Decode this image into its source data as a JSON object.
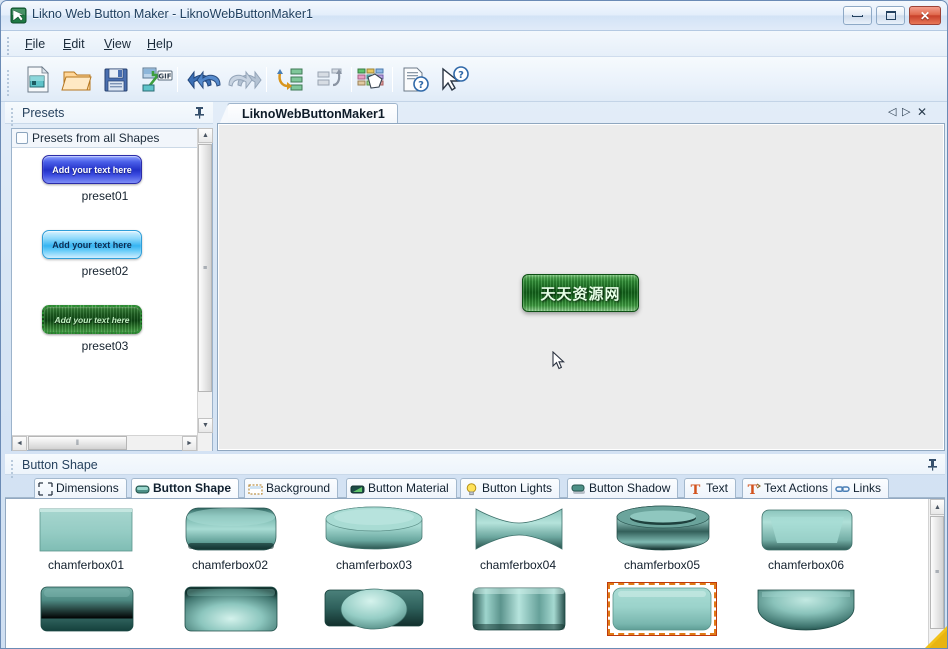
{
  "window": {
    "title": "Likno Web Button Maker - LiknoWebButtonMaker1",
    "app_icon": "likno-app-icon",
    "minimize_label": "Minimize",
    "maximize_label": "Maximize",
    "close_label": "Close"
  },
  "menu": {
    "items": [
      {
        "label": "File",
        "accel": "F"
      },
      {
        "label": "Edit",
        "accel": "E"
      },
      {
        "label": "View",
        "accel": "V"
      },
      {
        "label": "Help",
        "accel": "H"
      }
    ]
  },
  "toolbar": {
    "buttons": [
      {
        "name": "new-project-icon",
        "tooltip": "New"
      },
      {
        "name": "open-project-icon",
        "tooltip": "Open"
      },
      {
        "name": "save-project-icon",
        "tooltip": "Save"
      },
      {
        "name": "export-gif-icon",
        "tooltip": "Export GIF"
      },
      {
        "name": "undo-icon",
        "tooltip": "Undo"
      },
      {
        "name": "redo-icon",
        "tooltip": "Redo"
      },
      {
        "name": "import-buttons-icon",
        "tooltip": "Import"
      },
      {
        "name": "export-buttons-icon",
        "tooltip": "Export"
      },
      {
        "name": "properties-icon",
        "tooltip": "Properties"
      },
      {
        "name": "help-topics-icon",
        "tooltip": "Help Topics"
      },
      {
        "name": "whats-this-icon",
        "tooltip": "What's This?"
      }
    ]
  },
  "presets_panel": {
    "caption": "Presets",
    "pin_glyph": "⟐",
    "all_shapes_checkbox": {
      "label": "Presets from all Shapes",
      "checked": false
    },
    "items": [
      {
        "name": "preset01",
        "button_text": "Add your text here",
        "style": "pbtn1"
      },
      {
        "name": "preset02",
        "button_text": "Add your text here",
        "style": "pbtn2"
      },
      {
        "name": "preset03",
        "button_text": "Add your text here",
        "style": "pbtn3"
      }
    ],
    "scroll_h_thumb_glyph": "‖",
    "scroll_v_thumb_glyph": "≡"
  },
  "document_tabs": {
    "tabs": [
      {
        "label": "LiknoWebButtonMaker1",
        "active": true
      }
    ],
    "nav": {
      "prev_glyph": "◁",
      "next_glyph": "▷",
      "close_glyph": "✕"
    }
  },
  "canvas": {
    "button_text": "天天资源网",
    "background_color": "#ececec",
    "button_color": "#12631a",
    "cursor": "arrow-cursor"
  },
  "shape_panel": {
    "caption": "Button Shape",
    "pin_glyph": "⟐",
    "tabs": [
      {
        "label": "Dimensions",
        "icon": "dimensions-icon",
        "active": false
      },
      {
        "label": "Button Shape",
        "icon": "button-shape-icon",
        "active": true
      },
      {
        "label": "Background",
        "icon": "background-icon",
        "active": false
      },
      {
        "label": "Button Material",
        "icon": "material-icon",
        "active": false
      },
      {
        "label": "Button Lights",
        "icon": "lightbulb-icon",
        "active": false
      },
      {
        "label": "Button Shadow",
        "icon": "shadow-icon",
        "active": false
      },
      {
        "label": "Text",
        "icon": "text-icon",
        "active": false
      },
      {
        "label": "Text Actions",
        "icon": "text-actions-icon",
        "active": false
      },
      {
        "label": "Links",
        "icon": "links-icon",
        "active": false
      }
    ],
    "gallery": {
      "row1": [
        {
          "label": "chamferbox01",
          "shape": "flat-rect",
          "selected": false
        },
        {
          "label": "chamferbox02",
          "shape": "thick-round-top",
          "selected": false
        },
        {
          "label": "chamferbox03",
          "shape": "disc",
          "selected": false
        },
        {
          "label": "chamferbox04",
          "shape": "hourglass",
          "selected": false
        },
        {
          "label": "chamferbox05",
          "shape": "ring-bowl",
          "selected": false
        },
        {
          "label": "chamferbox06",
          "shape": "beveled-rect",
          "selected": false
        }
      ],
      "row2": [
        {
          "label": "",
          "shape": "rounded-dark",
          "selected": false
        },
        {
          "label": "",
          "shape": "domed-rect",
          "selected": false
        },
        {
          "label": "",
          "shape": "oval-on-rect",
          "selected": false
        },
        {
          "label": "",
          "shape": "grooved-rect",
          "selected": false
        },
        {
          "label": "",
          "shape": "plain-rounded",
          "selected": true
        },
        {
          "label": "",
          "shape": "bowl-rect",
          "selected": false
        }
      ],
      "scroll_thumb_glyph": "≡",
      "scroll_up_glyph": "▲"
    }
  },
  "colors": {
    "accent": "#2f6fb5",
    "selection_orange": "#e07b17",
    "shape_teal": "#8fc9c2",
    "close_red": "#c8412a",
    "canvas_gray": "#ececec"
  }
}
